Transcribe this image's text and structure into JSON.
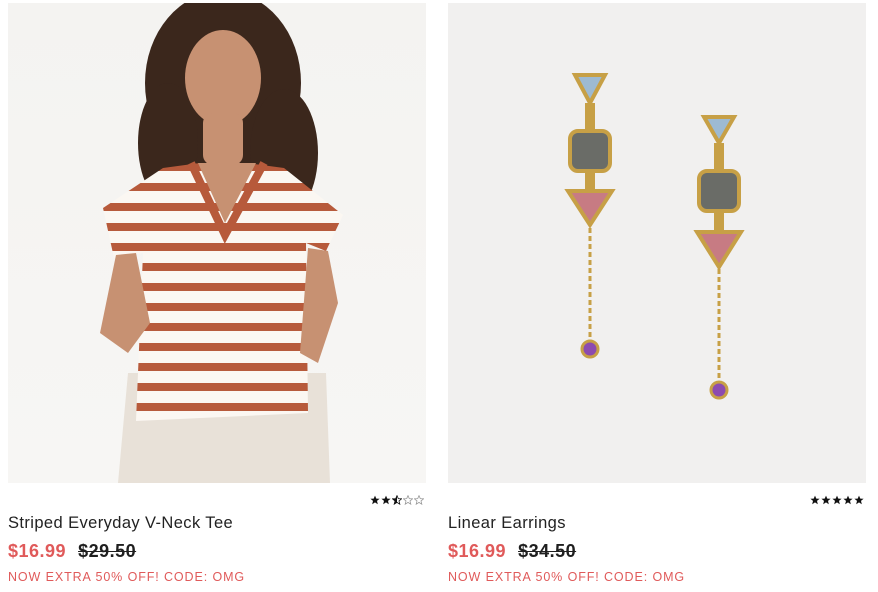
{
  "products": [
    {
      "name": "Striped Everyday V-Neck Tee",
      "image_alt": "Woman wearing a rust and white striped V-neck tee",
      "rating": 2.5,
      "rating_max": 5,
      "sale_price": "$16.99",
      "original_price": "$29.50",
      "promo": "NOW EXTRA 50% OFF! CODE: OMG"
    },
    {
      "name": "Linear Earrings",
      "image_alt": "Pair of gold linear drop earrings with blue, smoky, pink and purple stones",
      "rating": 5,
      "rating_max": 5,
      "sale_price": "$16.99",
      "original_price": "$34.50",
      "promo": "NOW EXTRA 50% OFF! CODE: OMG"
    }
  ],
  "colors": {
    "sale": "#e05a5a",
    "text": "#1f1f1f",
    "star": "#111111"
  }
}
